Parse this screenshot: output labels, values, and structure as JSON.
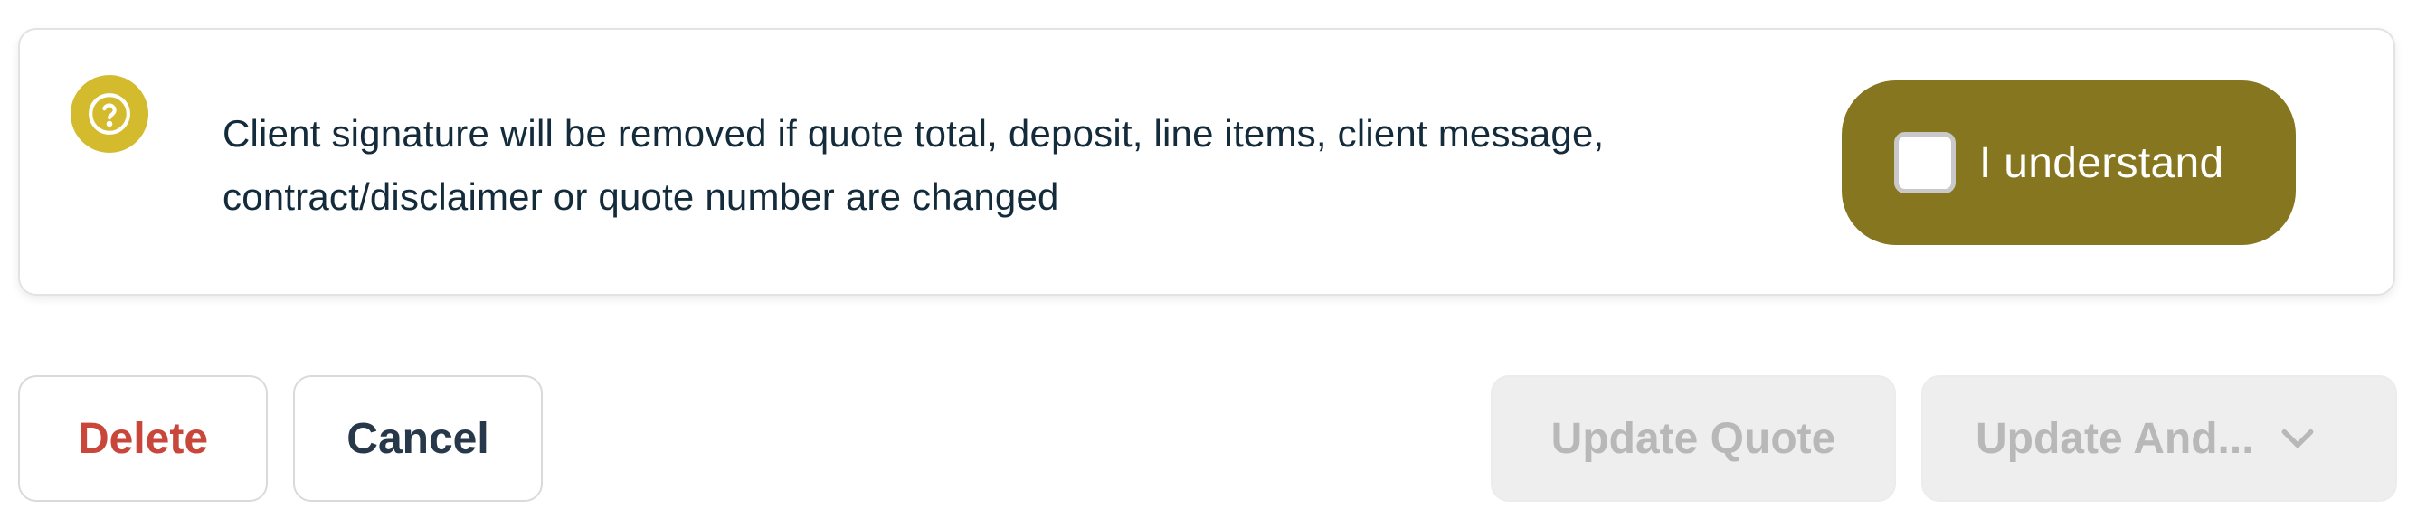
{
  "notice": {
    "icon": "help-circle-icon",
    "message_line1": "Client signature will be removed if quote total, deposit, line items, client message,",
    "message_line2": "contract/disclaimer or quote number are changed",
    "acknowledge": {
      "label": "I understand",
      "checked": false
    }
  },
  "actions": {
    "delete_label": "Delete",
    "cancel_label": "Cancel",
    "update_quote_label": "Update Quote",
    "update_and_label": "Update And...",
    "update_and_icon": "chevron-down-icon"
  },
  "colors": {
    "icon_bg": "#d3bb2d",
    "acknowledge_bg": "#86761f",
    "delete_text": "#c8463a",
    "body_text": "#132b3a",
    "disabled_bg": "#eeeeee",
    "disabled_text": "#b8b8b8"
  }
}
